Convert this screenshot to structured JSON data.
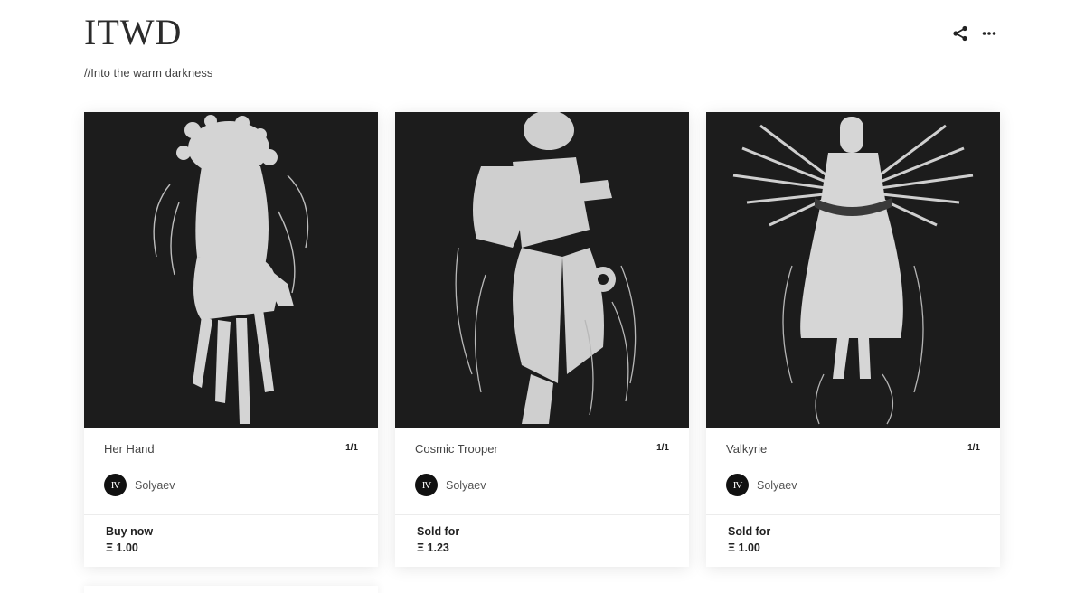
{
  "header": {
    "title": "ITWD",
    "subtitle": "//Into the warm darkness",
    "share_icon": "share-icon",
    "more_icon": "more-horizontal-icon"
  },
  "cards": [
    {
      "name": "Her Hand",
      "edition": "1/1",
      "creator": {
        "avatar_text": "IV",
        "name": "Solyaev"
      },
      "price_label": "Buy now",
      "price_value": "Ξ 1.00"
    },
    {
      "name": "Cosmic Trooper",
      "edition": "1/1",
      "creator": {
        "avatar_text": "IV",
        "name": "Solyaev"
      },
      "price_label": "Sold for",
      "price_value": "Ξ 1.23"
    },
    {
      "name": "Valkyrie",
      "edition": "1/1",
      "creator": {
        "avatar_text": "IV",
        "name": "Solyaev"
      },
      "price_label": "Sold for",
      "price_value": "Ξ 1.00"
    }
  ],
  "colors": {
    "artwork_background": "#1c1c1c",
    "artwork_foreground": "#d9d9d9",
    "text_primary": "#222222"
  }
}
